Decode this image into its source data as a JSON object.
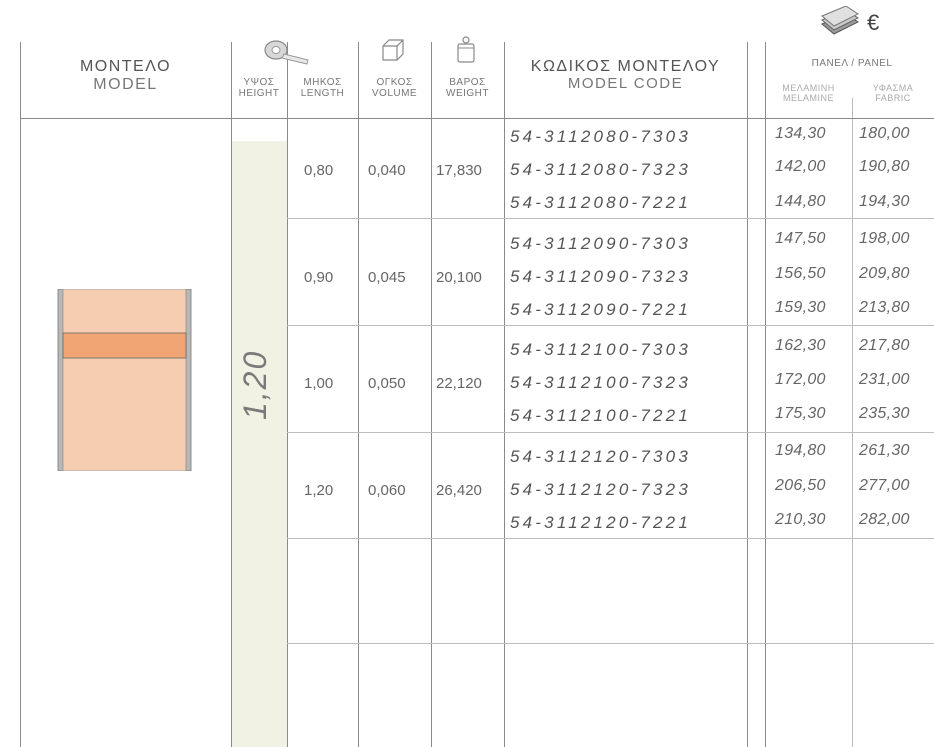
{
  "header": {
    "model_gr": "ΜΟΝΤΕΛΟ",
    "model_en": "MODEL",
    "height_gr": "ΥΨΟΣ",
    "height_en": "HEIGHT",
    "length_gr": "ΜΗΚΟΣ",
    "length_en": "LENGTH",
    "volume_gr": "ΟΓΚΟΣ",
    "volume_en": "VOLUME",
    "weight_gr": "ΒΑΡΟΣ",
    "weight_en": "WEIGHT",
    "code_gr": "ΚΩΔΙΚΟΣ ΜΟΝΤΕΛΟΥ",
    "code_en": "MODEL CODE",
    "currency": "€",
    "panel": "ΠΑΝΕΛ / PANEL",
    "melamine_gr": "ΜΕΛΑΜΙΝΗ",
    "melamine_en": "MELAMINE",
    "fabric_gr": "ΥΦΑΣΜΑ",
    "fabric_en": "FABRIC"
  },
  "icons": {
    "height": "tape-measure-icon",
    "volume": "cube-icon",
    "weight": "weight-icon",
    "price": "money-icon"
  },
  "colors": {
    "panel_fill": "#f6cdb0",
    "panel_stripe": "#f1a574",
    "height_band": "#f1f2e4"
  },
  "height_value": "1,20",
  "groups": [
    {
      "length": "0,80",
      "volume": "0,040",
      "weight": "17,830",
      "rows": [
        {
          "code": "54-3112080-7303",
          "melamine": "134,30",
          "fabric": "180,00"
        },
        {
          "code": "54-3112080-7323",
          "melamine": "142,00",
          "fabric": "190,80"
        },
        {
          "code": "54-3112080-7221",
          "melamine": "144,80",
          "fabric": "194,30"
        }
      ]
    },
    {
      "length": "0,90",
      "volume": "0,045",
      "weight": "20,100",
      "rows": [
        {
          "code": "54-3112090-7303",
          "melamine": "147,50",
          "fabric": "198,00"
        },
        {
          "code": "54-3112090-7323",
          "melamine": "156,50",
          "fabric": "209,80"
        },
        {
          "code": "54-3112090-7221",
          "melamine": "159,30",
          "fabric": "213,80"
        }
      ]
    },
    {
      "length": "1,00",
      "volume": "0,050",
      "weight": "22,120",
      "rows": [
        {
          "code": "54-3112100-7303",
          "melamine": "162,30",
          "fabric": "217,80"
        },
        {
          "code": "54-3112100-7323",
          "melamine": "172,00",
          "fabric": "231,00"
        },
        {
          "code": "54-3112100-7221",
          "melamine": "175,30",
          "fabric": "235,30"
        }
      ]
    },
    {
      "length": "1,20",
      "volume": "0,060",
      "weight": "26,420",
      "rows": [
        {
          "code": "54-3112120-7303",
          "melamine": "194,80",
          "fabric": "261,30"
        },
        {
          "code": "54-3112120-7323",
          "melamine": "206,50",
          "fabric": "277,00"
        },
        {
          "code": "54-3112120-7221",
          "melamine": "210,30",
          "fabric": "282,00"
        }
      ]
    }
  ]
}
